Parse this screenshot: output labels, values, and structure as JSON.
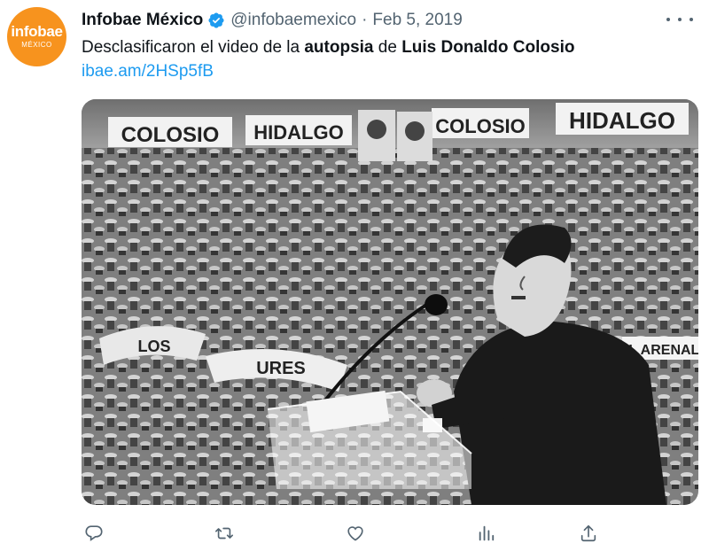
{
  "account": {
    "name": "Infobae México",
    "handle": "@infobaemexico",
    "separator": "·",
    "date": "Feb 5, 2019",
    "avatar_brand": "infobae",
    "avatar_sub": "MÉXICO",
    "brand_color": "#f7931e",
    "verified_color": "#1d9bf0"
  },
  "tweet": {
    "text_1": "Desclasificaron el video de la ",
    "text_2": "autopsia",
    "text_3": " de ",
    "text_4": "Luis Donaldo Colosio",
    "link": "ibae.am/2HSp5fB",
    "link_color": "#1d9bf0"
  },
  "media": {
    "description_icon": "black-and-white-photo",
    "banners": [
      "COLOSIO",
      "HIDALGO",
      "COLOSIO",
      "HIDALGO",
      "EL ARENAL",
      "URES",
      "LOS"
    ]
  },
  "actions": [
    {
      "name": "reply-icon"
    },
    {
      "name": "retweet-icon"
    },
    {
      "name": "like-icon"
    },
    {
      "name": "views-icon"
    },
    {
      "name": "share-icon"
    }
  ],
  "more_icon": "more-options-icon"
}
